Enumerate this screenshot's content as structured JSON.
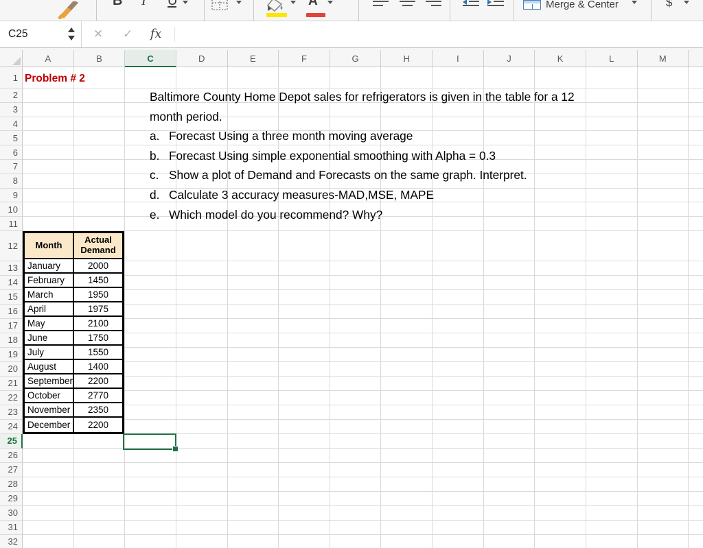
{
  "toolbar": {
    "bold": "B",
    "italic": "I",
    "underline": "U",
    "merge_center": "Merge & Center",
    "currency": "$"
  },
  "formula_bar": {
    "name_box": "C25",
    "cancel_glyph": "✕",
    "enter_glyph": "✓",
    "fx_label": "fx",
    "formula_value": ""
  },
  "grid": {
    "columns": [
      "A",
      "B",
      "C",
      "D",
      "E",
      "F",
      "G",
      "H",
      "I",
      "J",
      "K",
      "L",
      "M"
    ],
    "selected_column": "C",
    "selected_row": 25,
    "rows_visible": 32,
    "selected_cell": "C25"
  },
  "content": {
    "title": "Problem # 2",
    "intro_lines": [
      "Baltimore County Home Depot sales for refrigerators is given in the table for a 12",
      "month period."
    ],
    "tasks": [
      {
        "label": "a.",
        "text": "Forecast Using a three month moving average"
      },
      {
        "label": "b.",
        "text": "Forecast Using simple exponential smoothing with Alpha = 0.3"
      },
      {
        "label": "c.",
        "text": "Show a plot of Demand and Forecasts on the same graph. Interpret."
      },
      {
        "label": "d.",
        "text": "Calculate 3 accuracy measures-MAD,MSE, MAPE"
      },
      {
        "label": "e.",
        "text": "Which model do you recommend? Why?"
      }
    ]
  },
  "table": {
    "headers": [
      "Month",
      "Actual Demand"
    ],
    "rows": [
      {
        "month": "January",
        "demand": "2000"
      },
      {
        "month": "February",
        "demand": "1450"
      },
      {
        "month": "March",
        "demand": "1950"
      },
      {
        "month": "April",
        "demand": "1975"
      },
      {
        "month": "May",
        "demand": "2100"
      },
      {
        "month": "June",
        "demand": "1750"
      },
      {
        "month": "July",
        "demand": "1550"
      },
      {
        "month": "August",
        "demand": "1400"
      },
      {
        "month": "September",
        "demand": "2200"
      },
      {
        "month": "October",
        "demand": "2770"
      },
      {
        "month": "November",
        "demand": "2350"
      },
      {
        "month": "December",
        "demand": "2200"
      }
    ]
  },
  "colors": {
    "accent_green": "#1E7145",
    "title_red": "#C00000",
    "table_header_fill": "#FBE8C8",
    "highlight_yellow": "#FFE500",
    "font_color_red": "#E0443A"
  }
}
